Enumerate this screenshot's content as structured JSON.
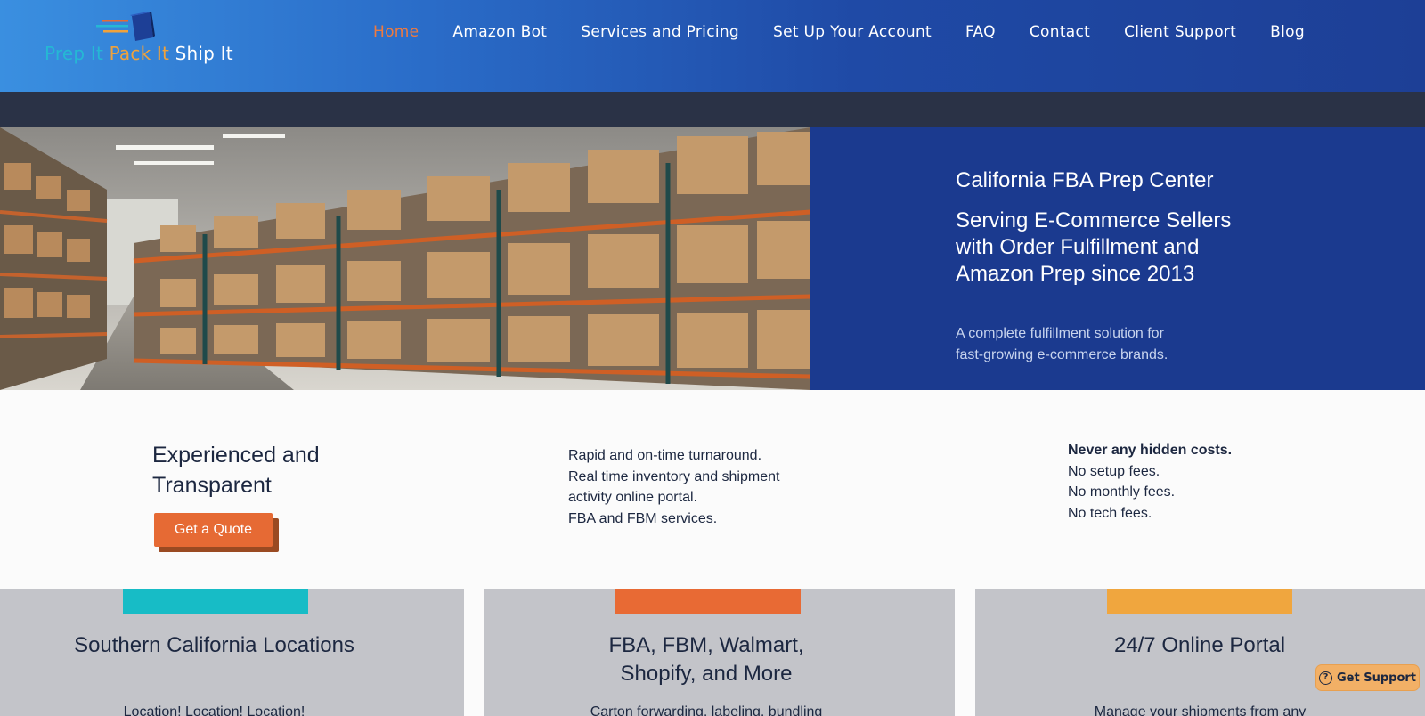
{
  "logo": {
    "word1": "Prep It",
    "word2": "Pack It",
    "word3": "Ship It"
  },
  "nav": {
    "items": [
      {
        "label": "Home",
        "active": true
      },
      {
        "label": "Amazon Bot"
      },
      {
        "label": "Services and Pricing"
      },
      {
        "label": "Set Up Your Account"
      },
      {
        "label": "FAQ"
      },
      {
        "label": "Contact"
      },
      {
        "label": "Client Support"
      },
      {
        "label": "Blog"
      }
    ]
  },
  "hero": {
    "title": "California FBA Prep Center",
    "subtitle": "Serving E-Commerce Sellers with Order Fulfillment and Amazon Prep since 2013",
    "description": "A complete fulfillment solution for fast-growing e-commerce brands.",
    "image_icon": "warehouse-shelves-photo"
  },
  "features": {
    "heading": "Experienced and Transparent",
    "quote_button": "Get a Quote",
    "col2": [
      "Rapid and on-time turnaround.",
      "Real time inventory and shipment activity online portal.",
      "FBA and FBM services."
    ],
    "col3_strong": "Never any hidden costs.",
    "col3": [
      "No setup fees.",
      "No monthly fees.",
      "No tech fees."
    ]
  },
  "cards": [
    {
      "title": "Southern California Locations",
      "text": "Location! Location! Location!",
      "accent": "#17bcc6"
    },
    {
      "title": "FBA, FBM, Walmart, Shopify, and More",
      "text": "Carton forwarding, labeling, bundling",
      "accent": "#e86a34"
    },
    {
      "title": "24/7 Online Portal",
      "text": "Manage your shipments from any",
      "accent": "#f0a63e"
    }
  ],
  "support": {
    "label": "Get Support",
    "icon": "help-circle-icon"
  },
  "colors": {
    "nav_active": "#f07a3e",
    "hero_panel": "#1b3a8f",
    "quote_button": "#e66a34",
    "subbar": "#2a3246"
  }
}
